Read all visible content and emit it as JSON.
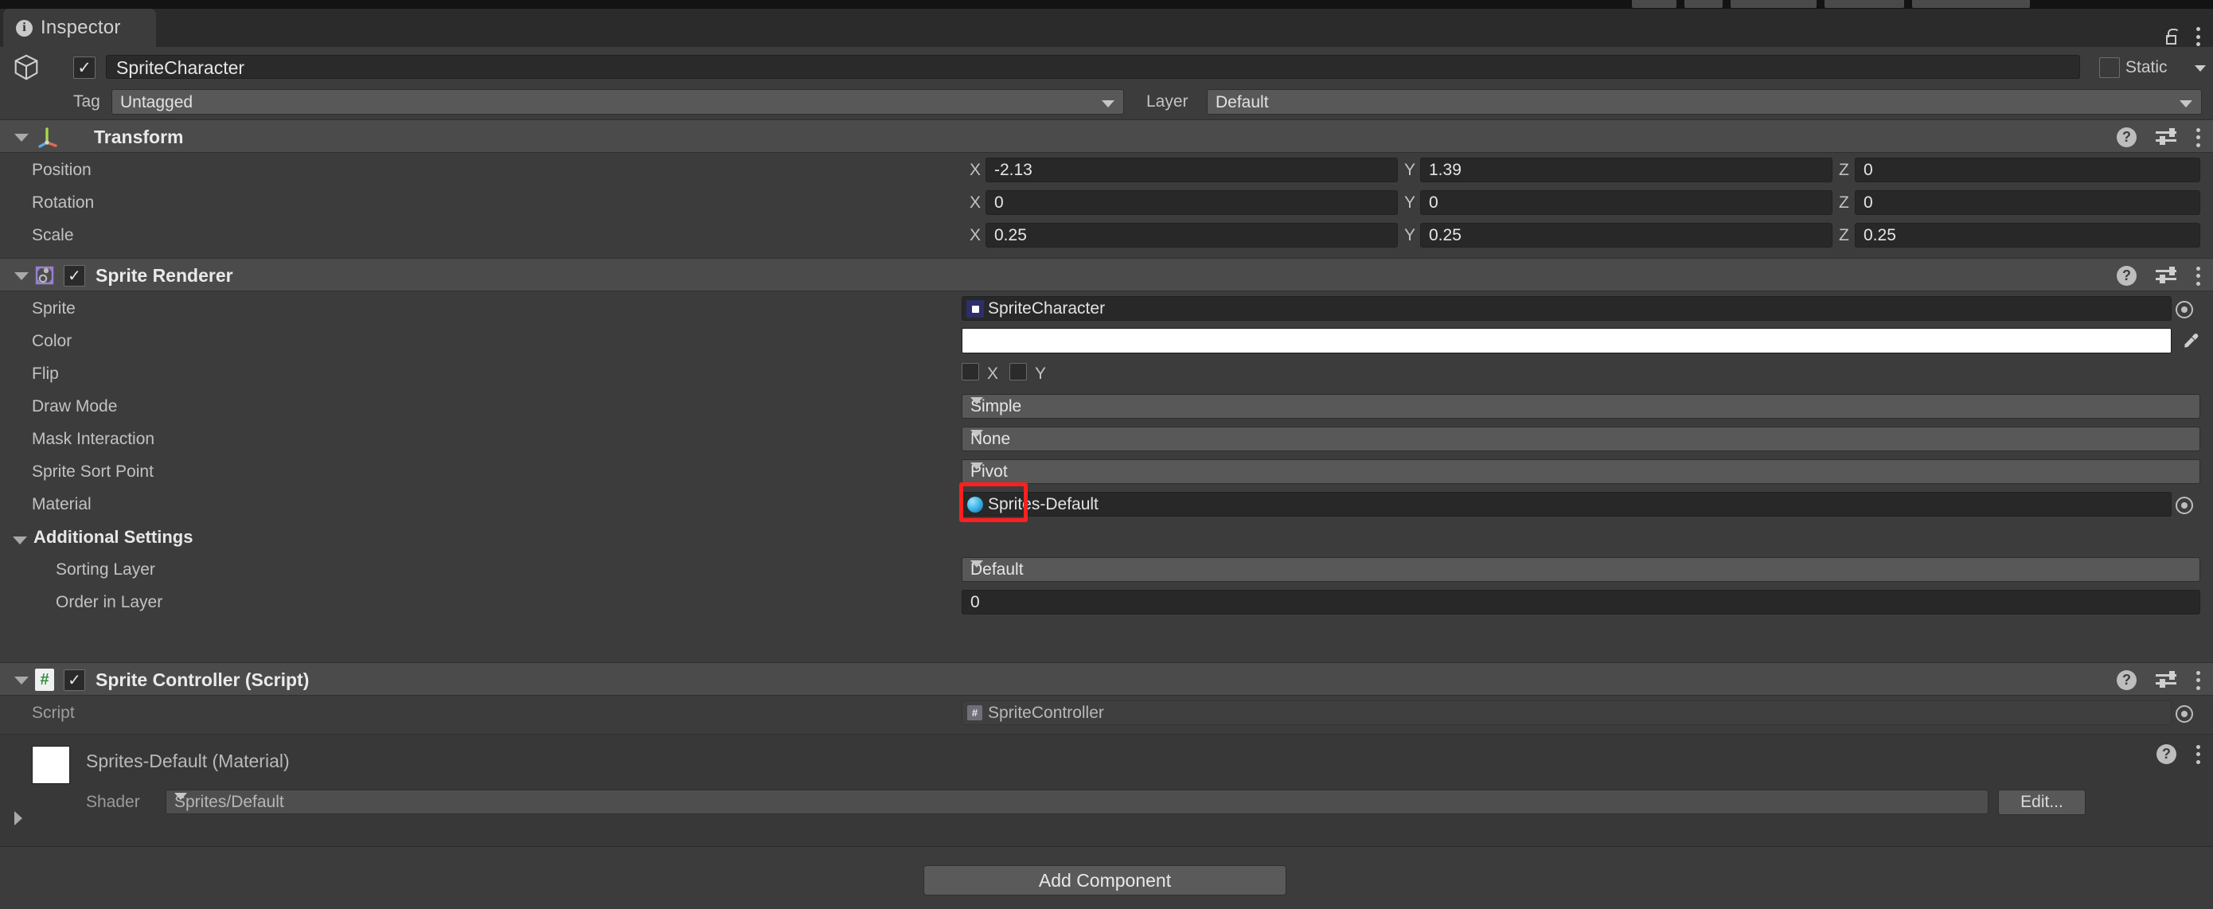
{
  "window": {
    "tab_label": "Inspector",
    "tab_icon": "info-icon",
    "lock_icon": "lock-icon",
    "menu_icon": "kebab-menu-icon"
  },
  "gameobject": {
    "icon": "cube-icon",
    "enabled": true,
    "enabled_glyph": "✓",
    "name": "SpriteCharacter",
    "static_label": "Static",
    "tag_label": "Tag",
    "tag_value": "Untagged",
    "layer_label": "Layer",
    "layer_value": "Default"
  },
  "components": [
    {
      "id": "transform",
      "title": "Transform",
      "icon": "transform-axis-icon",
      "has_checkbox": false,
      "rows": [
        {
          "label": "Position",
          "type": "vector3",
          "x": "-2.13",
          "y": "1.39",
          "z": "0"
        },
        {
          "label": "Rotation",
          "type": "vector3",
          "x": "0",
          "y": "0",
          "z": "0"
        },
        {
          "label": "Scale",
          "type": "vector3",
          "x": "0.25",
          "y": "0.25",
          "z": "0.25"
        }
      ]
    },
    {
      "id": "sprite-renderer",
      "title": "Sprite Renderer",
      "icon": "sprite-renderer-icon",
      "has_checkbox": true,
      "enabled_glyph": "✓",
      "rows": [
        {
          "label": "Sprite",
          "type": "object",
          "value": "SpriteCharacter",
          "thumb": "sprite-asset-icon"
        },
        {
          "label": "Color",
          "type": "color",
          "value": "#FFFFFF"
        },
        {
          "label": "Flip",
          "type": "flip",
          "x_label": "X",
          "y_label": "Y",
          "x_checked": false,
          "y_checked": false
        },
        {
          "label": "Draw Mode",
          "type": "popup",
          "value": "Simple"
        },
        {
          "label": "Mask Interaction",
          "type": "popup",
          "value": "None"
        },
        {
          "label": "Sprite Sort Point",
          "type": "popup",
          "value": "Pivot",
          "highlighted": true
        },
        {
          "label": "Material",
          "type": "object",
          "value": "Sprites-Default",
          "thumb": "material-ball-icon"
        },
        {
          "label": "Additional Settings",
          "type": "subheader"
        },
        {
          "label": "Sorting Layer",
          "type": "popup",
          "value": "Default",
          "indent": true
        },
        {
          "label": "Order in Layer",
          "type": "number",
          "value": "0",
          "indent": true
        }
      ]
    },
    {
      "id": "sprite-controller",
      "title": "Sprite Controller (Script)",
      "icon": "script-icon",
      "has_checkbox": true,
      "enabled_glyph": "✓",
      "rows": [
        {
          "label": "Script",
          "type": "object",
          "value": "SpriteController",
          "thumb": "script-asset-icon",
          "readonly": true
        }
      ]
    }
  ],
  "material_inspector": {
    "title": "Sprites-Default (Material)",
    "swatch_color": "#FFFFFF",
    "shader_label": "Shader",
    "shader_value": "Sprites/Default",
    "edit_label": "Edit..."
  },
  "footer": {
    "add_component_label": "Add Component"
  },
  "icons": {
    "help": "?",
    "preset": "preset-icon",
    "menu": "⋮"
  },
  "accent": {
    "highlight_red": "#FF2020",
    "sprite_renderer_purple": "#9a7fd0",
    "script_green": "#3f9a4f",
    "panel_bg": "#383838",
    "header_bg": "#4b4b4b"
  }
}
